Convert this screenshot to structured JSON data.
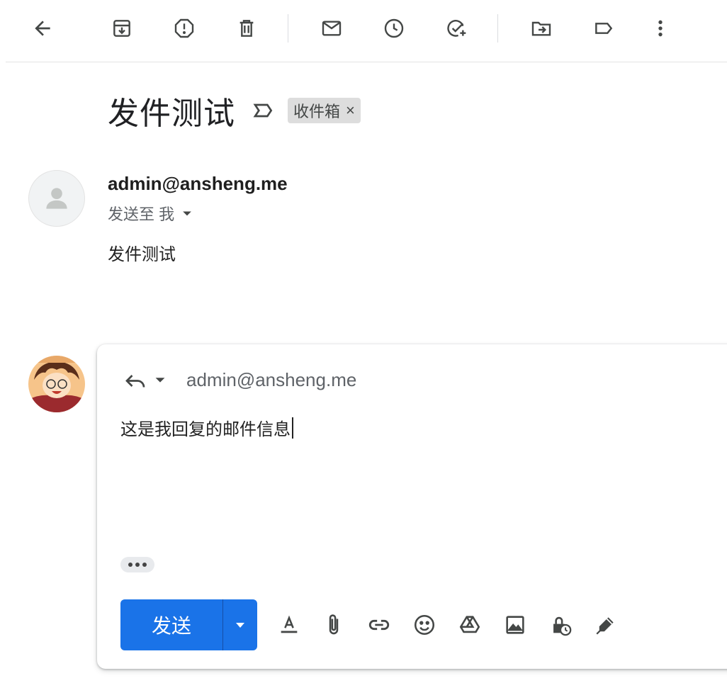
{
  "toolbar": {
    "icons": [
      "back-arrow-icon",
      "archive-icon",
      "report-spam-icon",
      "delete-icon",
      "mark-unread-icon",
      "snooze-icon",
      "add-to-tasks-icon",
      "move-to-icon",
      "label-icon",
      "more-vert-icon"
    ],
    "icon_color": "#444746"
  },
  "message": {
    "subject": "发件测试",
    "label_chip": "收件箱",
    "label_chip_close": "×",
    "sender": "admin@ansheng.me",
    "to_line": "发送至 我",
    "body": "发件测试"
  },
  "reply": {
    "to": "admin@ansheng.me",
    "body": "这是我回复的邮件信息",
    "send_label": "发送",
    "format_icons": [
      "text-format-icon",
      "attach-file-icon",
      "insert-link-icon",
      "emoji-icon",
      "google-drive-icon",
      "insert-photo-icon",
      "confidential-mode-icon",
      "signature-icon"
    ],
    "accent": "#1a73e8"
  }
}
